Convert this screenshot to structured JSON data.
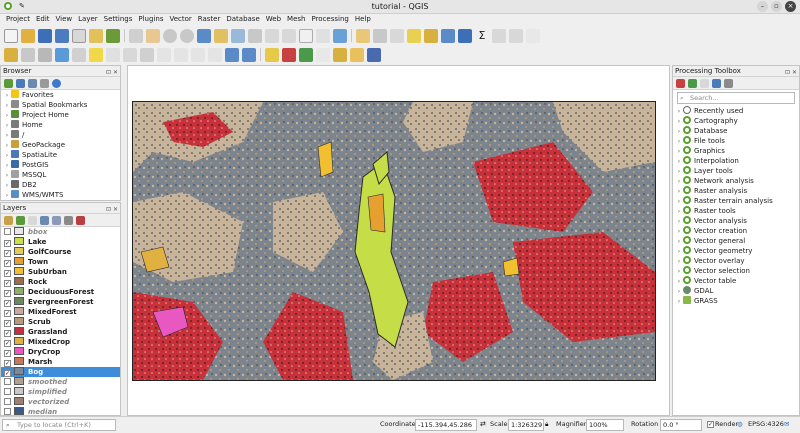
{
  "window": {
    "title": "tutorial - QGIS"
  },
  "menu": [
    "Project",
    "Edit",
    "View",
    "Layer",
    "Settings",
    "Plugins",
    "Vector",
    "Raster",
    "Database",
    "Web",
    "Mesh",
    "Processing",
    "Help"
  ],
  "browser": {
    "title": "Browser",
    "items": [
      {
        "label": "Favorites",
        "icon": "star-icon",
        "color": "#f5c518"
      },
      {
        "label": "Spatial Bookmarks",
        "icon": "bookmark-icon",
        "color": "#8a8a8a"
      },
      {
        "label": "Project Home",
        "icon": "folder-icon",
        "color": "#5a8f3a"
      },
      {
        "label": "Home",
        "icon": "folder-icon",
        "color": "#7a7a7a"
      },
      {
        "label": "/",
        "icon": "folder-icon",
        "color": "#7a7a7a"
      },
      {
        "label": "GeoPackage",
        "icon": "geopackage-icon",
        "color": "#c7a23a"
      },
      {
        "label": "SpatiaLite",
        "icon": "spatialite-icon",
        "color": "#4a78b8"
      },
      {
        "label": "PostGIS",
        "icon": "postgis-icon",
        "color": "#3c6aa8"
      },
      {
        "label": "MSSQL",
        "icon": "mssql-icon",
        "color": "#a0a0a0"
      },
      {
        "label": "DB2",
        "icon": "db2-icon",
        "color": "#6a6a6a"
      },
      {
        "label": "WMS/WMTS",
        "icon": "wms-icon",
        "color": "#5b8fc2"
      }
    ]
  },
  "layers": {
    "title": "Layers",
    "items": [
      {
        "label": "bbox",
        "checked": false,
        "color": "#e8e8e8",
        "dim": true,
        "selected": false
      },
      {
        "label": "Lake",
        "checked": true,
        "color": "#c8e04a",
        "dim": false,
        "selected": false
      },
      {
        "label": "GolfCourse",
        "checked": true,
        "color": "#e7c95a",
        "dim": false,
        "selected": false
      },
      {
        "label": "Town",
        "checked": true,
        "color": "#e6a030",
        "dim": false,
        "selected": false
      },
      {
        "label": "SubUrban",
        "checked": true,
        "color": "#f0c030",
        "dim": false,
        "selected": false
      },
      {
        "label": "Rock",
        "checked": true,
        "color": "#9a6e50",
        "dim": false,
        "selected": false
      },
      {
        "label": "DeciduousForest",
        "checked": true,
        "color": "#8fae6a",
        "dim": false,
        "selected": false
      },
      {
        "label": "EvergreenForest",
        "checked": true,
        "color": "#6d8a5e",
        "dim": false,
        "selected": false
      },
      {
        "label": "MixedForest",
        "checked": true,
        "color": "#c8a8a0",
        "dim": false,
        "selected": false
      },
      {
        "label": "Scrub",
        "checked": true,
        "color": "#b89a7a",
        "dim": false,
        "selected": false
      },
      {
        "label": "Grassland",
        "checked": true,
        "color": "#c83040",
        "dim": false,
        "selected": false
      },
      {
        "label": "MixedCrop",
        "checked": true,
        "color": "#e0b040",
        "dim": false,
        "selected": false
      },
      {
        "label": "DryCrop",
        "checked": true,
        "color": "#e858c0",
        "dim": false,
        "selected": false
      },
      {
        "label": "Marsh",
        "checked": true,
        "color": "#c87a58",
        "dim": false,
        "selected": false
      },
      {
        "label": "Bog",
        "checked": true,
        "color": "#7a8a98",
        "dim": false,
        "selected": true
      },
      {
        "label": "smoothed",
        "checked": false,
        "color": "#b0a090",
        "dim": true,
        "selected": false
      },
      {
        "label": "simplified",
        "checked": false,
        "color": "#c8c8c8",
        "dim": true,
        "selected": false
      },
      {
        "label": "vectorized",
        "checked": false,
        "color": "#a08070",
        "dim": true,
        "selected": false
      },
      {
        "label": "median",
        "checked": false,
        "color": "#3a5a8a",
        "dim": true,
        "selected": false
      }
    ]
  },
  "locator": {
    "placeholder": "Type to locate (Ctrl+K)"
  },
  "processing": {
    "title": "Processing Toolbox",
    "search_placeholder": "Search...",
    "items": [
      {
        "label": "Recently used",
        "icon": "clock-icon"
      },
      {
        "label": "Cartography",
        "icon": "qgis-icon"
      },
      {
        "label": "Database",
        "icon": "qgis-icon"
      },
      {
        "label": "File tools",
        "icon": "qgis-icon"
      },
      {
        "label": "Graphics",
        "icon": "qgis-icon"
      },
      {
        "label": "Interpolation",
        "icon": "qgis-icon"
      },
      {
        "label": "Layer tools",
        "icon": "qgis-icon"
      },
      {
        "label": "Network analysis",
        "icon": "qgis-icon"
      },
      {
        "label": "Raster analysis",
        "icon": "qgis-icon"
      },
      {
        "label": "Raster terrain analysis",
        "icon": "qgis-icon"
      },
      {
        "label": "Raster tools",
        "icon": "qgis-icon"
      },
      {
        "label": "Vector analysis",
        "icon": "qgis-icon"
      },
      {
        "label": "Vector creation",
        "icon": "qgis-icon"
      },
      {
        "label": "Vector general",
        "icon": "qgis-icon"
      },
      {
        "label": "Vector geometry",
        "icon": "qgis-icon"
      },
      {
        "label": "Vector overlay",
        "icon": "qgis-icon"
      },
      {
        "label": "Vector selection",
        "icon": "qgis-icon"
      },
      {
        "label": "Vector table",
        "icon": "qgis-icon"
      },
      {
        "label": "GDAL",
        "icon": "gdal-icon"
      },
      {
        "label": "GRASS",
        "icon": "grass-icon"
      }
    ]
  },
  "status": {
    "coordinate_label": "Coordinate",
    "coordinate": "-115.394,45.286",
    "scale_label": "Scale",
    "scale": "1:326329",
    "magnifier_label": "Magnifier",
    "magnifier": "100%",
    "rotation_label": "Rotation",
    "rotation": "0.0 °",
    "render_label": "Render",
    "crs": "EPSG:4326"
  }
}
